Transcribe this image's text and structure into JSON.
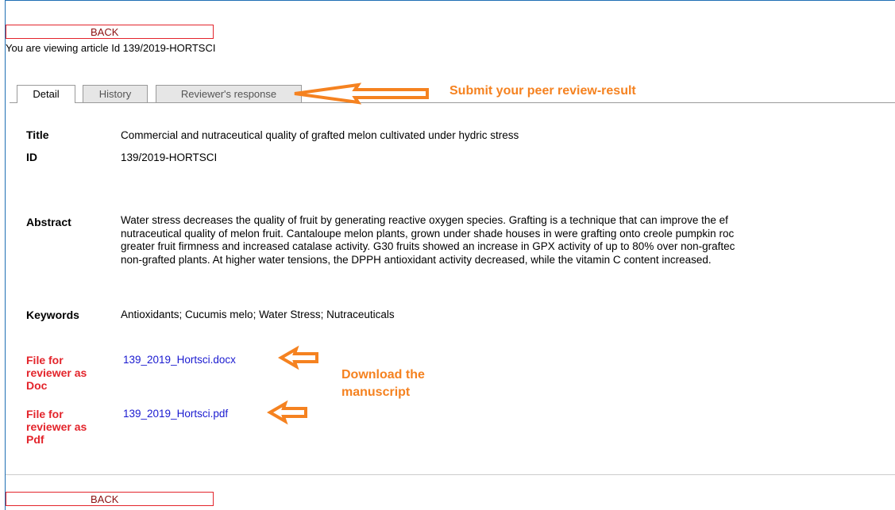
{
  "nav": {
    "back_label": "BACK"
  },
  "viewing_text": "You are viewing article Id 139/2019-HORTSCI",
  "tabs": [
    {
      "label": "Detail",
      "active": true
    },
    {
      "label": "History",
      "active": false
    },
    {
      "label": "Reviewer's response",
      "active": false
    }
  ],
  "annotations": {
    "submit_note": "Submit your peer review-result",
    "download_note_line1": "Download the",
    "download_note_line2": "manuscript"
  },
  "article": {
    "title_label": "Title",
    "title": "Commercial and nutraceutical quality of grafted melon cultivated under hydric stress",
    "id_label": "ID",
    "id": "139/2019-HORTSCI",
    "abstract_label": "Abstract",
    "abstract_lines": [
      "Water stress decreases the quality of fruit by generating reactive oxygen species. Grafting is a technique that can improve the ef",
      "nutraceutical quality of melon fruit. Cantaloupe melon plants, grown under shade houses in were grafting onto creole pumpkin roc",
      "greater fruit firmness and increased catalase activity. G30 fruits showed an increase in GPX activity of up to 80% over non-graftec",
      "non-grafted plants. At higher water tensions, the DPPH antioxidant activity decreased, while the vitamin C content increased."
    ],
    "keywords_label": "Keywords",
    "keywords": "Antioxidants; Cucumis melo; Water Stress; Nutraceuticals"
  },
  "files": [
    {
      "label_lines": [
        "File for",
        "reviewer as",
        "Doc"
      ],
      "link": "139_2019_Hortsci.docx"
    },
    {
      "label_lines": [
        "File for",
        "reviewer as",
        "Pdf"
      ],
      "link": "139_2019_Hortsci.pdf"
    }
  ],
  "colors": {
    "frame": "#1f6fb4",
    "back_border": "#e3242b",
    "annotation": "#f58220",
    "file_label": "#e3242b",
    "link": "#1a1ad0"
  },
  "icons": [
    "left-arrow-annotation-icon"
  ]
}
